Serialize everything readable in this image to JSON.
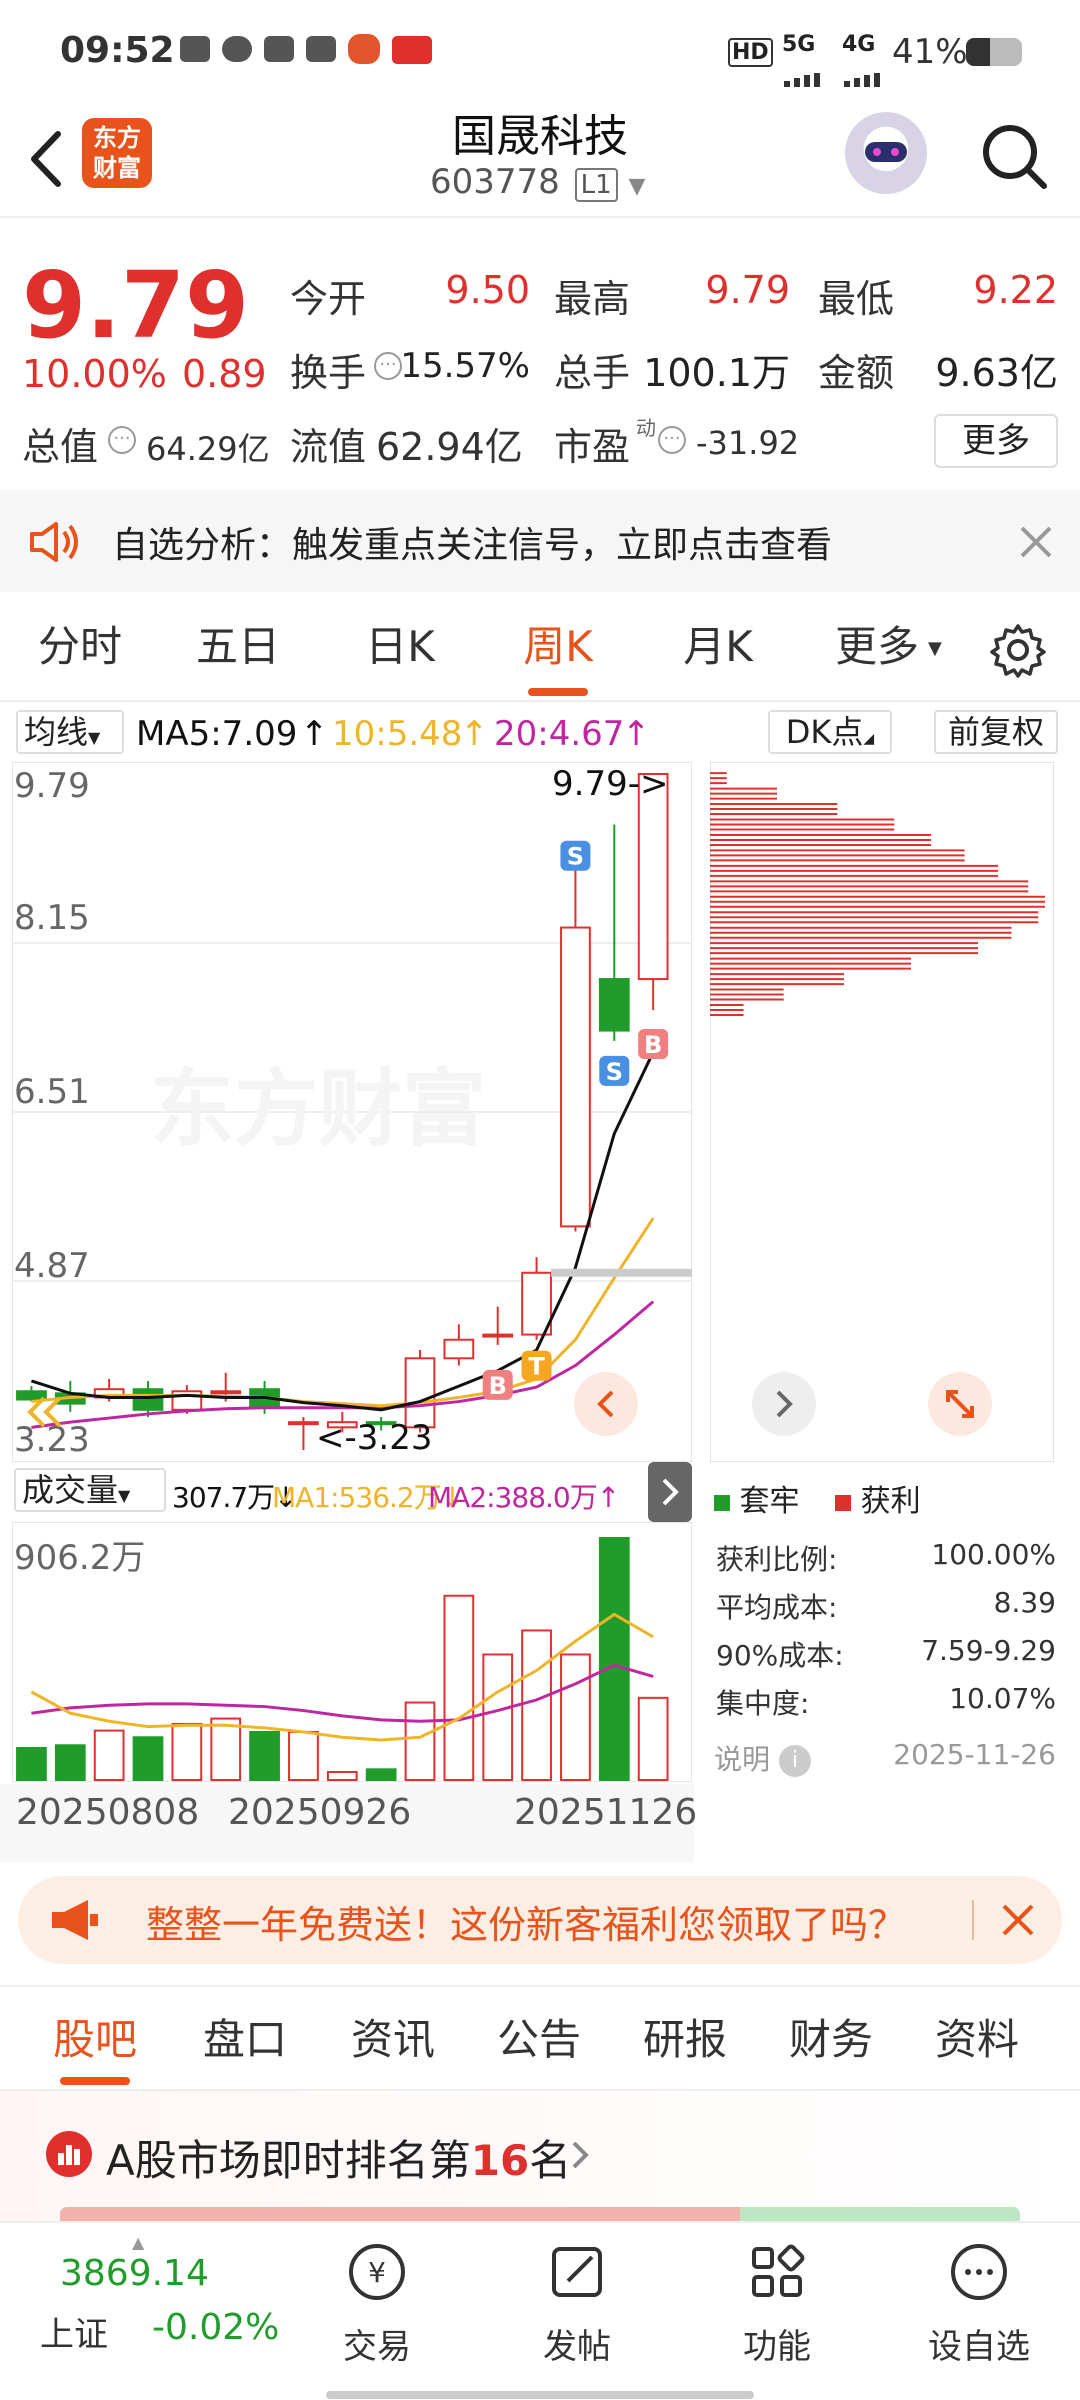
{
  "status_bar": {
    "time": "09:52",
    "network": "5G",
    "network2": "4G",
    "hd": "HD",
    "battery": "41%"
  },
  "nav": {
    "logo_line1": "东方",
    "logo_line2": "财富",
    "title": "国晟科技",
    "code": "603778",
    "level": "L1"
  },
  "quote": {
    "price": "9.79",
    "change_pct": "10.00%",
    "change": "0.89",
    "open_label": "今开",
    "open": "9.50",
    "high_label": "最高",
    "high": "9.79",
    "low_label": "最低",
    "low": "9.22",
    "turnover_label": "换手",
    "turnover": "15.57%",
    "volume_label": "总手",
    "volume": "100.1万",
    "amount_label": "金额",
    "amount": "9.63亿",
    "mktcap_label": "总值",
    "mktcap": "64.29亿",
    "float_label": "流值",
    "float": "62.94亿",
    "pe_label": "市盈",
    "pe_sup": "动",
    "pe": "-31.92",
    "more_button": "更多"
  },
  "notice": {
    "text": "自选分析：触发重点关注信号，立即点击查看"
  },
  "chart_tabs": [
    "分时",
    "五日",
    "日K",
    "周K",
    "月K",
    "更多"
  ],
  "chart_tabs_active": "周K",
  "ma_bar": {
    "selector": "均线",
    "ma5": "MA5:7.09",
    "ma10": "10:5.48",
    "ma20": "20:4.67",
    "dk_button": "DK点",
    "adjust_button": "前复权"
  },
  "price_axis": {
    "p1": "9.79",
    "p2": "8.15",
    "p3": "6.51",
    "p4": "4.87",
    "p5": "3.23"
  },
  "annotations": {
    "high": "9.79->",
    "low": "<-3.23",
    "watermark": "东方财富"
  },
  "volume_bar": {
    "selector": "成交量",
    "vol": "307.7万",
    "ma1": "MA1:536.2万",
    "ma2": "MA2:388.0万",
    "max": "906.2万"
  },
  "dates": {
    "d1": "20250808",
    "d2": "20250926",
    "d3": "20251126"
  },
  "cost_legend": {
    "trapped": "套牢",
    "profit": "获利"
  },
  "cost_info": [
    {
      "label": "获利比例:",
      "value": "100.00%"
    },
    {
      "label": "平均成本:",
      "value": "8.39"
    },
    {
      "label": "90%成本:",
      "value": "7.59-9.29"
    },
    {
      "label": "集中度:",
      "value": "10.07%"
    }
  ],
  "cost_footer": {
    "explain": "说明",
    "date": "2025-11-26"
  },
  "promo": {
    "text": "整整一年免费送！这份新客福利您领取了吗？"
  },
  "bottom_tabs": [
    "股吧",
    "盘口",
    "资讯",
    "公告",
    "研报",
    "财务",
    "资料"
  ],
  "rank": {
    "prefix": "A股市场即时排名第",
    "num": "16",
    "suffix": "名"
  },
  "bottom_bar": {
    "index_value": "3869.14",
    "index_name": "上证",
    "index_change": "-0.02%",
    "trade": "交易",
    "post": "发帖",
    "func": "功能",
    "watch": "设自选"
  },
  "colors": {
    "up": "#e0302e",
    "down": "#1f9c2a",
    "accent": "#e8531c",
    "ma5": "#111111",
    "ma10": "#f0b429",
    "ma20": "#c026a0"
  },
  "chart_data": {
    "type": "candlestick",
    "period": "weekly",
    "ylim": [
      3.23,
      9.79
    ],
    "candles": [
      {
        "o": 3.8,
        "c": 3.72,
        "h": 3.85,
        "l": 3.7
      },
      {
        "o": 3.78,
        "c": 3.68,
        "h": 3.9,
        "l": 3.6
      },
      {
        "o": 3.74,
        "c": 3.82,
        "h": 3.92,
        "l": 3.7
      },
      {
        "o": 3.82,
        "c": 3.62,
        "h": 3.9,
        "l": 3.55
      },
      {
        "o": 3.62,
        "c": 3.8,
        "h": 3.86,
        "l": 3.58
      },
      {
        "o": 3.8,
        "c": 3.8,
        "h": 3.98,
        "l": 3.7
      },
      {
        "o": 3.82,
        "c": 3.64,
        "h": 3.9,
        "l": 3.58
      },
      {
        "o": 3.5,
        "c": 3.5,
        "h": 3.55,
        "l": 3.23
      },
      {
        "o": 3.45,
        "c": 3.5,
        "h": 3.6,
        "l": 3.4
      },
      {
        "o": 3.5,
        "c": 3.48,
        "h": 3.55,
        "l": 3.42
      },
      {
        "o": 3.45,
        "c": 4.12,
        "h": 4.2,
        "l": 3.4
      },
      {
        "o": 4.12,
        "c": 4.3,
        "h": 4.45,
        "l": 4.05
      },
      {
        "o": 4.35,
        "c": 4.35,
        "h": 4.62,
        "l": 4.25
      },
      {
        "o": 4.35,
        "c": 4.95,
        "h": 5.1,
        "l": 4.3
      },
      {
        "o": 5.4,
        "c": 8.3,
        "h": 8.9,
        "l": 5.35
      },
      {
        "o": 7.8,
        "c": 7.3,
        "h": 9.3,
        "l": 7.2
      },
      {
        "o": 7.8,
        "c": 9.79,
        "h": 9.79,
        "l": 7.5
      }
    ],
    "volume": [
      120,
      130,
      185,
      160,
      210,
      230,
      180,
      180,
      30,
      40,
      290,
      690,
      470,
      560,
      470,
      906.2,
      307.7
    ],
    "ma5": [
      3.9,
      3.78,
      3.74,
      3.74,
      3.76,
      3.74,
      3.74,
      3.69,
      3.66,
      3.62,
      3.7,
      3.85,
      4.0,
      4.2,
      5.0,
      6.3,
      7.09
    ],
    "ma10": [
      3.7,
      3.74,
      3.76,
      3.76,
      3.76,
      3.75,
      3.74,
      3.7,
      3.68,
      3.66,
      3.69,
      3.74,
      3.8,
      3.92,
      4.3,
      4.9,
      5.48
    ],
    "ma20": [
      3.45,
      3.5,
      3.54,
      3.58,
      3.61,
      3.63,
      3.64,
      3.64,
      3.64,
      3.64,
      3.66,
      3.7,
      3.76,
      3.84,
      4.05,
      4.35,
      4.67
    ],
    "vol_ma1": [
      330,
      250,
      220,
      200,
      205,
      205,
      195,
      180,
      160,
      150,
      160,
      230,
      330,
      410,
      520,
      620,
      536.2
    ],
    "vol_ma2": [
      250,
      270,
      280,
      285,
      285,
      280,
      275,
      260,
      240,
      225,
      220,
      225,
      260,
      300,
      360,
      430,
      388.0
    ],
    "signals": [
      {
        "index": 14,
        "label": "S"
      },
      {
        "index": 15,
        "label": "S"
      },
      {
        "index": 16,
        "label": "B"
      },
      {
        "index": 12,
        "label": "B"
      },
      {
        "index": 13,
        "label": "T"
      }
    ],
    "cost_distribution_bins": [
      {
        "price": 9.75,
        "weight": 0.05
      },
      {
        "price": 9.6,
        "weight": 0.2
      },
      {
        "price": 9.45,
        "weight": 0.38
      },
      {
        "price": 9.3,
        "weight": 0.55
      },
      {
        "price": 9.15,
        "weight": 0.66
      },
      {
        "price": 9.0,
        "weight": 0.76
      },
      {
        "price": 8.85,
        "weight": 0.86
      },
      {
        "price": 8.7,
        "weight": 0.95
      },
      {
        "price": 8.55,
        "weight": 1.0
      },
      {
        "price": 8.4,
        "weight": 0.98
      },
      {
        "price": 8.25,
        "weight": 0.9
      },
      {
        "price": 8.1,
        "weight": 0.8
      },
      {
        "price": 7.95,
        "weight": 0.6
      },
      {
        "price": 7.8,
        "weight": 0.4
      },
      {
        "price": 7.65,
        "weight": 0.22
      },
      {
        "price": 7.5,
        "weight": 0.1
      }
    ]
  }
}
